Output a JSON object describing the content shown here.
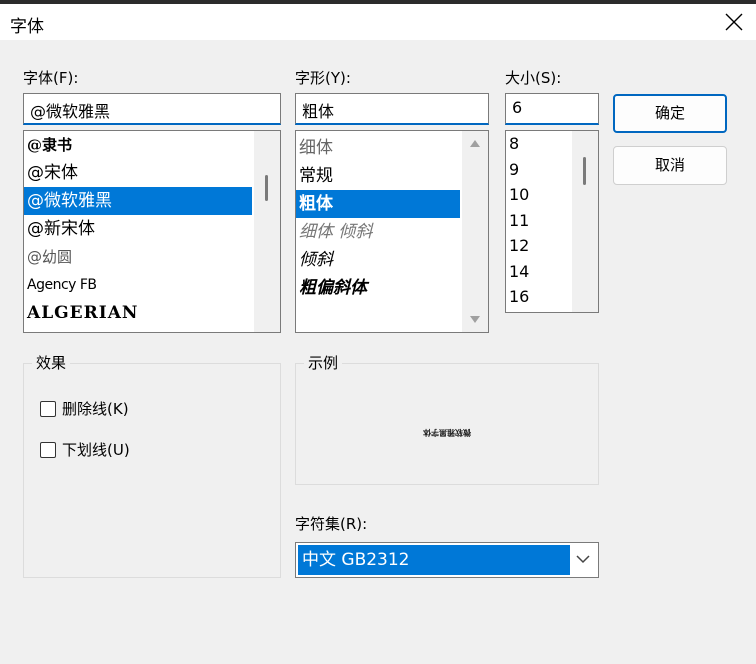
{
  "dialog": {
    "title": "字体"
  },
  "font": {
    "label": "字体(F):",
    "value": "@微软雅黑",
    "items": [
      "@隶书",
      "@宋体",
      "@微软雅黑",
      "@新宋体",
      "@幼圆",
      "Agency FB",
      "ALGERIAN"
    ],
    "selected_index": 2
  },
  "style": {
    "label": "字形(Y):",
    "value": "粗体",
    "items": [
      "细体",
      "常规",
      "粗体",
      "细体 倾斜",
      "倾斜",
      "粗偏斜体"
    ],
    "selected_index": 2
  },
  "size": {
    "label": "大小(S):",
    "value": "6",
    "items": [
      "8",
      "9",
      "10",
      "11",
      "12",
      "14",
      "16"
    ]
  },
  "buttons": {
    "ok": "确定",
    "cancel": "取消"
  },
  "effects": {
    "title": "效果",
    "strikeout": "删除线(K)",
    "underline": "下划线(U)",
    "strikeout_checked": false,
    "underline_checked": false
  },
  "sample": {
    "title": "示例",
    "text": "微软雅黑字体"
  },
  "charset": {
    "label": "字符集(R):",
    "value": "中文 GB2312"
  },
  "colors": {
    "accent": "#0078d7",
    "focus_border": "#0067c0"
  }
}
